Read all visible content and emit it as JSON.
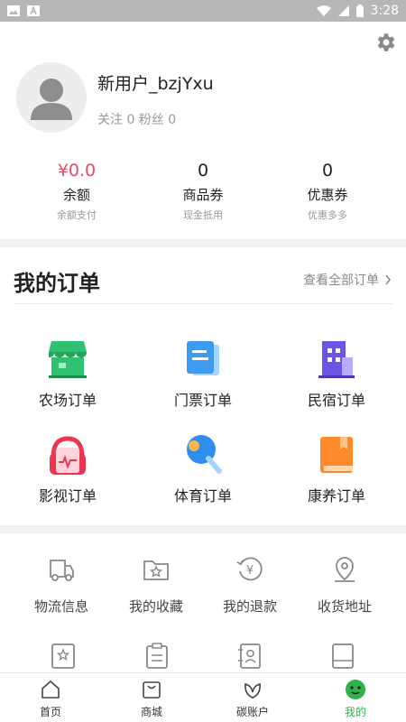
{
  "status_bar": {
    "time": "3:28"
  },
  "profile": {
    "username": "新用户_bzjYxu",
    "follow_text": "关注 0 粉丝 0"
  },
  "stats": [
    {
      "value": "¥0.0",
      "label": "余额",
      "sub": "余额支付"
    },
    {
      "value": "0",
      "label": "商品券",
      "sub": "现金抵用"
    },
    {
      "value": "0",
      "label": "优惠券",
      "sub": "优惠多多"
    }
  ],
  "orders": {
    "title": "我的订单",
    "view_all": "查看全部订单",
    "items": [
      {
        "label": "农场订单",
        "icon": "shop-icon"
      },
      {
        "label": "门票订单",
        "icon": "ticket-icon"
      },
      {
        "label": "民宿订单",
        "icon": "building-icon"
      },
      {
        "label": "影视订单",
        "icon": "headphones-icon"
      },
      {
        "label": "体育订单",
        "icon": "ping-pong-icon"
      },
      {
        "label": "康养订单",
        "icon": "book-icon"
      }
    ]
  },
  "services": [
    {
      "label": "物流信息",
      "icon": "truck-icon"
    },
    {
      "label": "我的收藏",
      "icon": "favorite-folder-icon"
    },
    {
      "label": "我的退款",
      "icon": "refund-icon"
    },
    {
      "label": "收货地址",
      "icon": "location-icon"
    }
  ],
  "tabbar": [
    {
      "label": "首页",
      "icon": "home-icon"
    },
    {
      "label": "商城",
      "icon": "bag-icon"
    },
    {
      "label": "碳账户",
      "icon": "leaf-icon"
    },
    {
      "label": "我的",
      "icon": "smiley-icon",
      "active": true
    }
  ],
  "colors": {
    "accent_green": "#2fb24a",
    "price_red": "#e94b64"
  }
}
